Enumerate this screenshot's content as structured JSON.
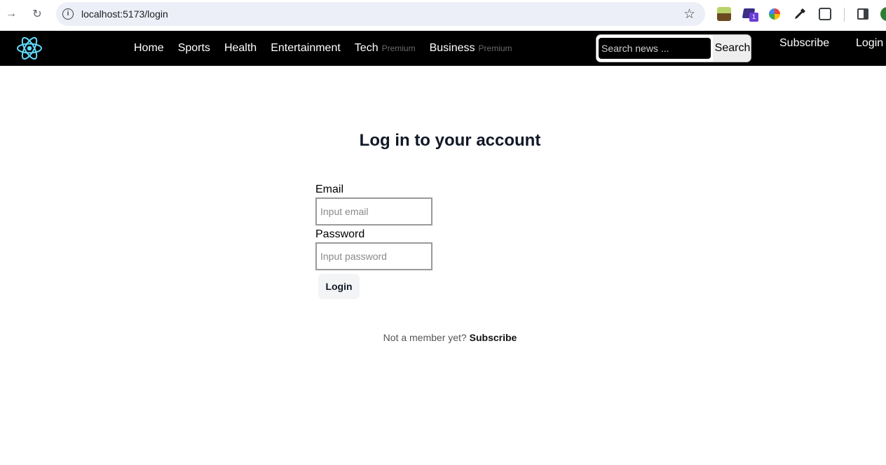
{
  "browser": {
    "url": "localhost:5173/login",
    "extension_badge": "1"
  },
  "navbar": {
    "links": [
      {
        "label": "Home",
        "badge": ""
      },
      {
        "label": "Sports",
        "badge": ""
      },
      {
        "label": "Health",
        "badge": ""
      },
      {
        "label": "Entertainment",
        "badge": ""
      },
      {
        "label": "Tech",
        "badge": "Premium"
      },
      {
        "label": "Business",
        "badge": "Premium"
      }
    ],
    "search_placeholder": "Search news ...",
    "search_button": "Search",
    "subscribe": "Subscribe",
    "login": "Login",
    "logo_color": "#61dafb"
  },
  "login": {
    "title": "Log in to your account",
    "email_label": "Email",
    "email_placeholder": "Input email",
    "password_label": "Password",
    "password_placeholder": "Input password",
    "button": "Login",
    "footer_text": "Not a member yet?",
    "footer_link": "Subscribe"
  }
}
